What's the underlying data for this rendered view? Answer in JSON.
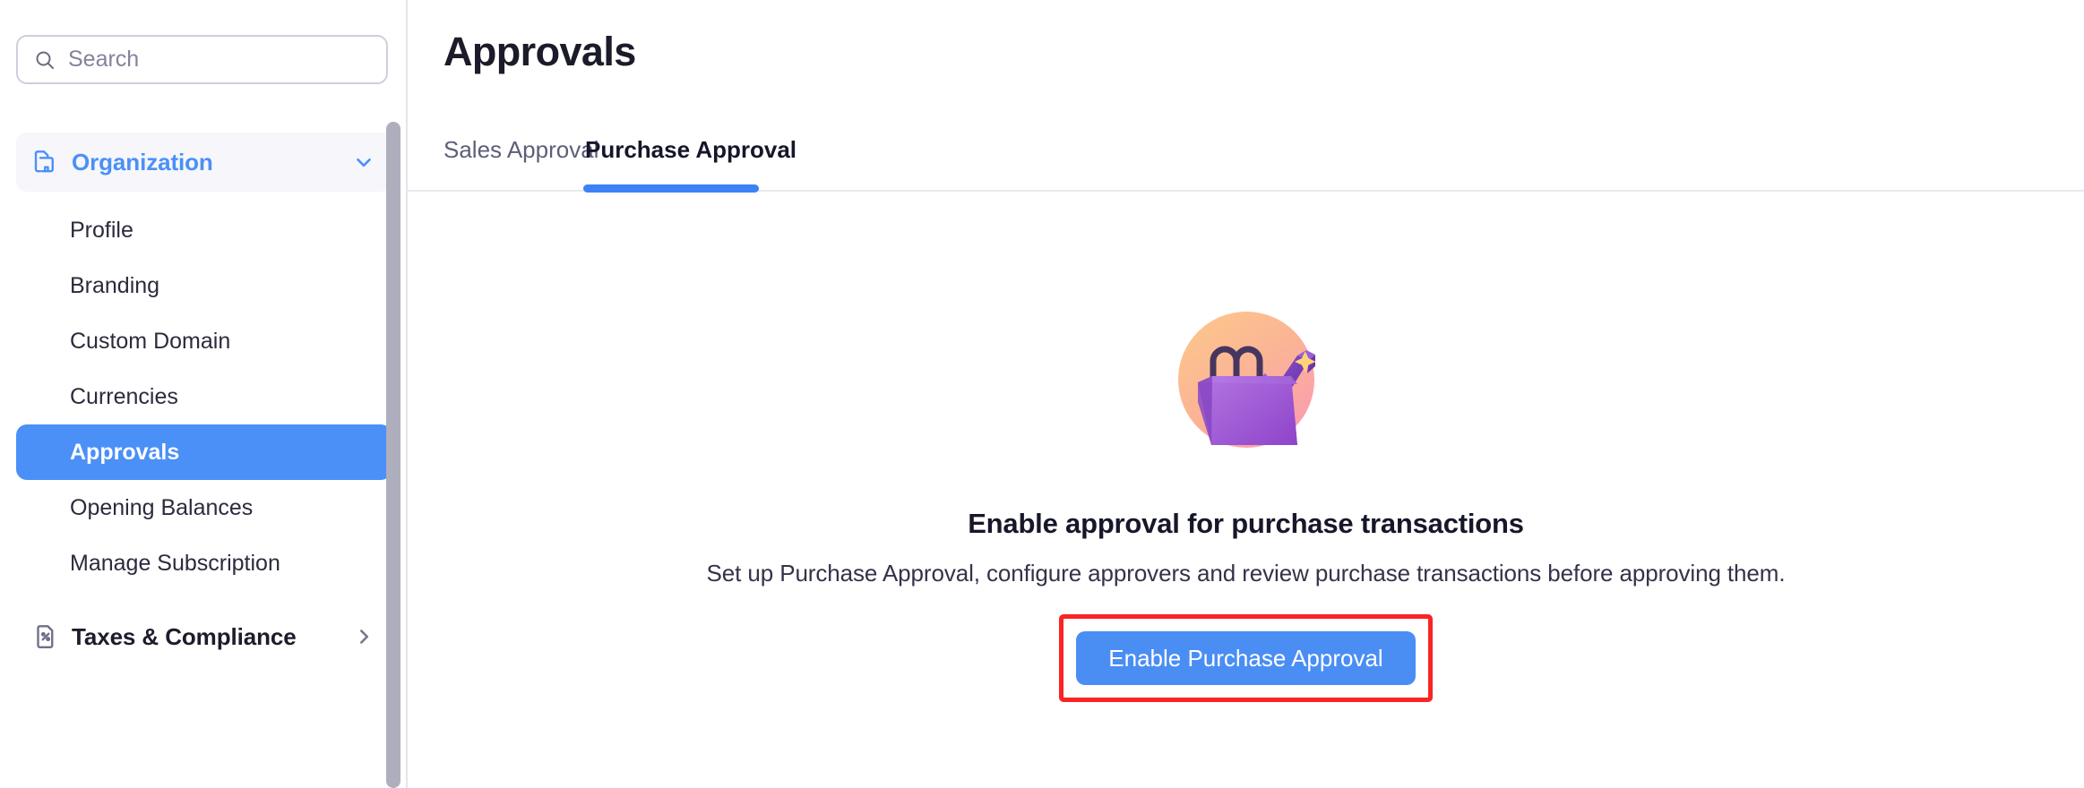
{
  "sidebar": {
    "search": {
      "placeholder": "Search",
      "value": "",
      "icon": "search-icon"
    },
    "groups": [
      {
        "label": "Organization",
        "icon": "organization-icon",
        "state": "expanded",
        "chevron": "chevron-down-icon",
        "active": true,
        "items": [
          {
            "label": "Profile",
            "active": false
          },
          {
            "label": "Branding",
            "active": false
          },
          {
            "label": "Custom Domain",
            "active": false
          },
          {
            "label": "Currencies",
            "active": false
          },
          {
            "label": "Approvals",
            "active": true
          },
          {
            "label": "Opening Balances",
            "active": false
          },
          {
            "label": "Manage Subscription",
            "active": false
          }
        ]
      },
      {
        "label": "Taxes & Compliance",
        "icon": "tax-document-percent-icon",
        "state": "collapsed",
        "chevron": "chevron-right-icon",
        "active": false,
        "items": []
      }
    ],
    "scrollbar": {
      "name": "sidebar-scrollbar"
    }
  },
  "main": {
    "title": "Approvals",
    "tabs": [
      {
        "label": "Sales Approval",
        "active": false
      },
      {
        "label": "Purchase Approval",
        "active": true
      }
    ],
    "empty_state": {
      "illustration": "shopping-bag-checkmark-illustration",
      "heading": "Enable approval for purchase transactions",
      "description": "Set up Purchase Approval, configure approvers and review purchase transactions before approving them.",
      "cta_label": "Enable Purchase Approval"
    }
  },
  "colors": {
    "accent_blue": "#4a90f7",
    "cta_blue": "#4a8ef4",
    "highlight_red": "#fb2323",
    "active_nav_bg": "#4a90f7",
    "group_head_bg": "#f6f6fb",
    "text_dark": "#1b1b2a",
    "text_muted": "#5e5e7a",
    "border": "#e6e6ea",
    "scrollbar": "#aeaebd",
    "illus_circle_from": "#fbbf86",
    "illus_circle_to": "#fb9fb1",
    "illus_bag": "#a05ad6",
    "illus_check": "#8b4fd6",
    "illus_spark": "#ffd37a"
  }
}
